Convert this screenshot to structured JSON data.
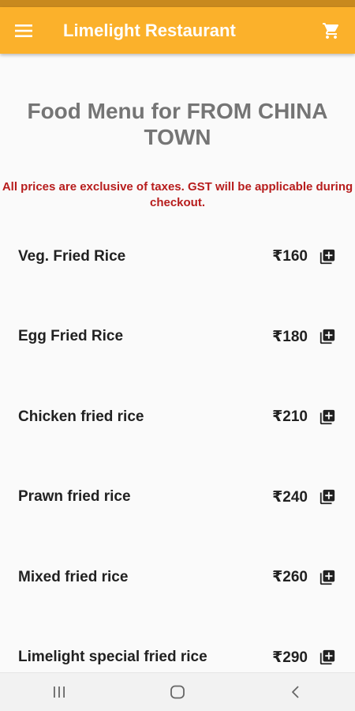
{
  "app_bar": {
    "title": "Limelight Restaurant",
    "menu_icon": "hamburger-menu-icon",
    "cart_icon": "shopping-cart-icon",
    "background": "#fbb12b"
  },
  "page": {
    "heading": "Food Menu for FROM CHINA TOWN",
    "notice": "All prices are exclusive of taxes. GST will be applicable during checkout."
  },
  "menu": {
    "items": [
      {
        "name": "Veg. Fried Rice",
        "price": "₹160"
      },
      {
        "name": "Egg Fried Rice",
        "price": "₹180"
      },
      {
        "name": "Chicken fried rice",
        "price": "₹210"
      },
      {
        "name": "Prawn fried rice",
        "price": "₹240"
      },
      {
        "name": "Mixed fried rice",
        "price": "₹260"
      },
      {
        "name": "Limelight special fried rice",
        "price": "₹290"
      }
    ],
    "add_icon": "add-to-cart-icon"
  },
  "nav": {
    "recents_icon": "recents-icon",
    "home_icon": "home-icon",
    "back_icon": "back-icon"
  }
}
